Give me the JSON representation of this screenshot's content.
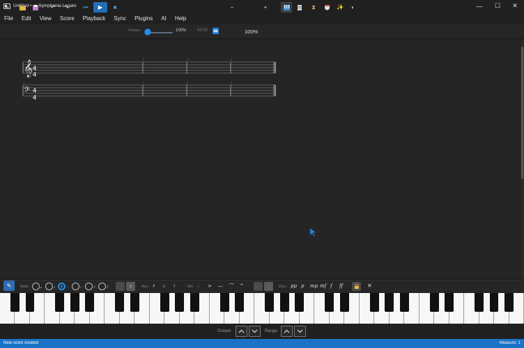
{
  "window": {
    "title": "Untitled • — Symphonia Legato",
    "controls": [
      "—",
      "☐",
      "✕"
    ]
  },
  "menu": [
    "File",
    "Edit",
    "View",
    "Score",
    "Playback",
    "Sync",
    "Plugins",
    "AI",
    "Help"
  ],
  "toolbar": {
    "new_icon": "+",
    "open_icon": "folder",
    "save_icon": "save",
    "undo": "↶",
    "redo": "↷",
    "rewind": "⏮",
    "play": "▶",
    "stop": "■",
    "tempo_label": "Tempo:",
    "tempo_value": "100%",
    "tempo_fraction": 0.0,
    "time": "00:00",
    "zoom_out": "−",
    "zoom_value": "100%",
    "zoom_in": "+",
    "mode_icons": [
      "piano-icon",
      "score-icon",
      "hourglass-icon",
      "mask-icon",
      "sparkle-icon",
      "contrast-icon"
    ],
    "accent": "#1f6fb8"
  },
  "score": {
    "time_signature": {
      "top": "4",
      "bottom": "4"
    },
    "measure_numbers": [
      "1",
      "2",
      "3",
      "4"
    ],
    "clefs": [
      "treble",
      "bass"
    ]
  },
  "palette": {
    "note_label": "Note:",
    "note_values": [
      "𝅝",
      "𝅗𝅥",
      "♩",
      "♪",
      "𝅘𝅥𝅯",
      "𝅘𝅥𝅰"
    ],
    "selected_note_index": 2,
    "acc_label": "Acc:",
    "accidentals": [
      "♯",
      "♭",
      "♮"
    ],
    "art_label": "Art:",
    "articulations": [
      ".",
      ">",
      "—",
      "⌒",
      "^"
    ],
    "dyn_label": "Dyn:",
    "dynamics": [
      "pp",
      "p",
      "mp",
      "mf",
      "f",
      "ff"
    ],
    "close": "✕"
  },
  "octave": {
    "octave_label": "Octave:",
    "range_label": "Range:"
  },
  "status": {
    "left": "New score created",
    "right": "Measure: 1"
  }
}
